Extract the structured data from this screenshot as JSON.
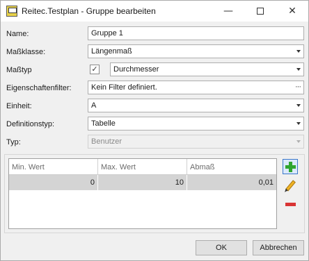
{
  "window": {
    "title": "Reitec.Testplan - Gruppe bearbeiten",
    "icons": [
      "app-icon",
      "minimize-icon",
      "maximize-icon",
      "close-icon"
    ]
  },
  "form": {
    "name_label": "Name:",
    "name_value": "Gruppe 1",
    "massklasse_label": "Maßklasse:",
    "massklasse_value": "Längenmaß",
    "masstyp_label": "Maßtyp",
    "masstyp_checked": true,
    "masstyp_value": "Durchmesser",
    "filter_label": "Eigenschaftenfilter:",
    "filter_value": "Kein Filter definiert.",
    "filter_button": "···",
    "einheit_label": "Einheit:",
    "einheit_value": "A",
    "definitionstyp_label": "Definitionstyp:",
    "definitionstyp_value": "Tabelle",
    "typ_label": "Typ:",
    "typ_value": "Benutzer"
  },
  "table": {
    "columns": [
      "Min. Wert",
      "Max. Wert",
      "Abmaß"
    ],
    "rows": [
      [
        "0",
        "10",
        "0,01"
      ]
    ]
  },
  "toolbar": {
    "icons": [
      "add-icon",
      "edit-icon",
      "delete-icon"
    ],
    "colors": {
      "add": "#2fa52f",
      "delete": "#d93434",
      "edit": "#f0b323"
    }
  },
  "buttons": {
    "ok": "OK",
    "cancel": "Abbrechen"
  }
}
